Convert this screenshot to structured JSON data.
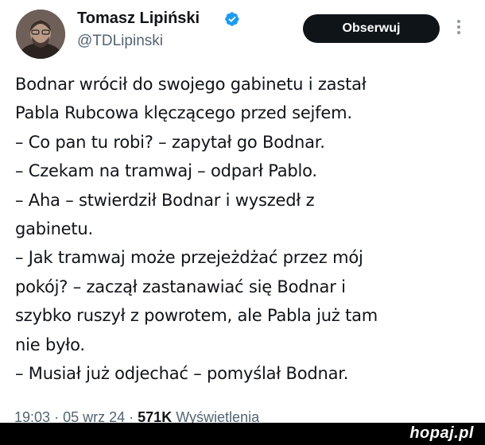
{
  "author": {
    "name": "Tomasz Lipiński",
    "handle": "@TDLipinski",
    "verified_icon": "verified-badge-icon"
  },
  "actions": {
    "follow_label": "Obserwuj",
    "more_icon": "more-vertical-icon"
  },
  "tweet": {
    "lines": [
      "Bodnar wrócił do swojego gabinetu i zastał",
      "Pabla Rubcowa klęczącego przed sejfem.",
      "– Co pan tu robi? – zapytał go Bodnar.",
      "– Czekam na tramwaj – odparł Pablo.",
      "– Aha – stwierdził Bodnar i wyszedł z",
      "gabinetu.",
      "– Jak tramwaj może przejeżdżać przez mój",
      "pokój? – zaczął zastanawiać się Bodnar i",
      "szybko ruszył z powrotem, ale Pabla już tam",
      "nie było.",
      "– Musiał już odjechać – pomyślał Bodnar."
    ]
  },
  "meta": {
    "time": "19:03",
    "separator": "·",
    "date": "05 wrz 24",
    "views_count": "571K",
    "views_label": "Wyświetlenia"
  },
  "watermark": "hopaj.pl",
  "colors": {
    "text": "#0f1419",
    "muted": "#536471",
    "verified": "#1d9bf0",
    "button_bg": "#0f1419"
  }
}
